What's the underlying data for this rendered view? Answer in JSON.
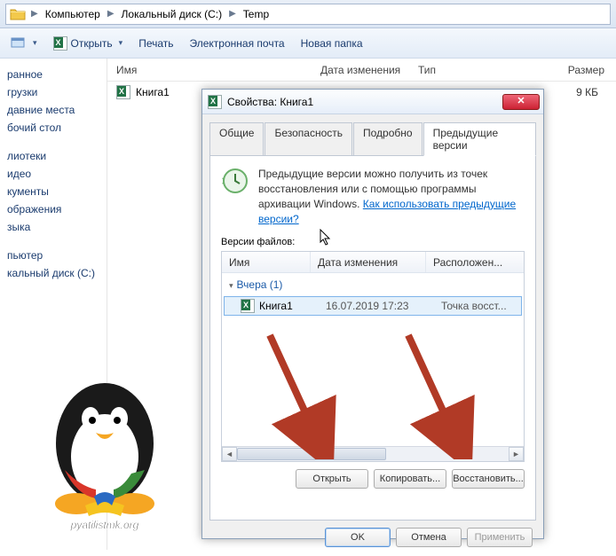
{
  "breadcrumb": {
    "items": [
      "Компьютер",
      "Локальный диск (C:)",
      "Temp"
    ]
  },
  "toolbar": {
    "open": "Открыть",
    "print": "Печать",
    "email": "Электронная почта",
    "newfolder": "Новая папка"
  },
  "sidebar": {
    "items1": [
      "ранное",
      "грузки",
      "давние места",
      "бочий стол"
    ],
    "items2": [
      "лиотеки",
      "идео",
      "кументы",
      "ображения",
      "зыка"
    ],
    "items3": [
      "пьютер",
      "кальный диск (C:)"
    ]
  },
  "list": {
    "headers": {
      "name": "Имя",
      "date": "Дата изменения",
      "type": "Тип",
      "size": "Размер"
    },
    "rows": [
      {
        "name": "Книга1",
        "size": "9 КБ"
      }
    ]
  },
  "dialog": {
    "title": "Свойства: Книга1",
    "tabs": [
      "Общие",
      "Безопасность",
      "Подробно",
      "Предыдущие версии"
    ],
    "active_tab": 3,
    "info_text": "Предыдущие версии можно получить из точек восстановления или с помощью программы архивации Windows. ",
    "info_link": "Как использовать предыдущие версии?",
    "versions_label": "Версии файлов:",
    "versions_header": {
      "name": "Имя",
      "date": "Дата изменения",
      "loc": "Расположен..."
    },
    "group": "Вчера (1)",
    "version_row": {
      "name": "Книга1",
      "date": "16.07.2019 17:23",
      "loc": "Точка восст..."
    },
    "btn_open": "Открыть",
    "btn_copy": "Копировать...",
    "btn_restore": "Восстановить...",
    "btn_ok": "OK",
    "btn_cancel": "Отмена",
    "btn_apply": "Применить"
  },
  "watermark": "pyatilistmk.org"
}
